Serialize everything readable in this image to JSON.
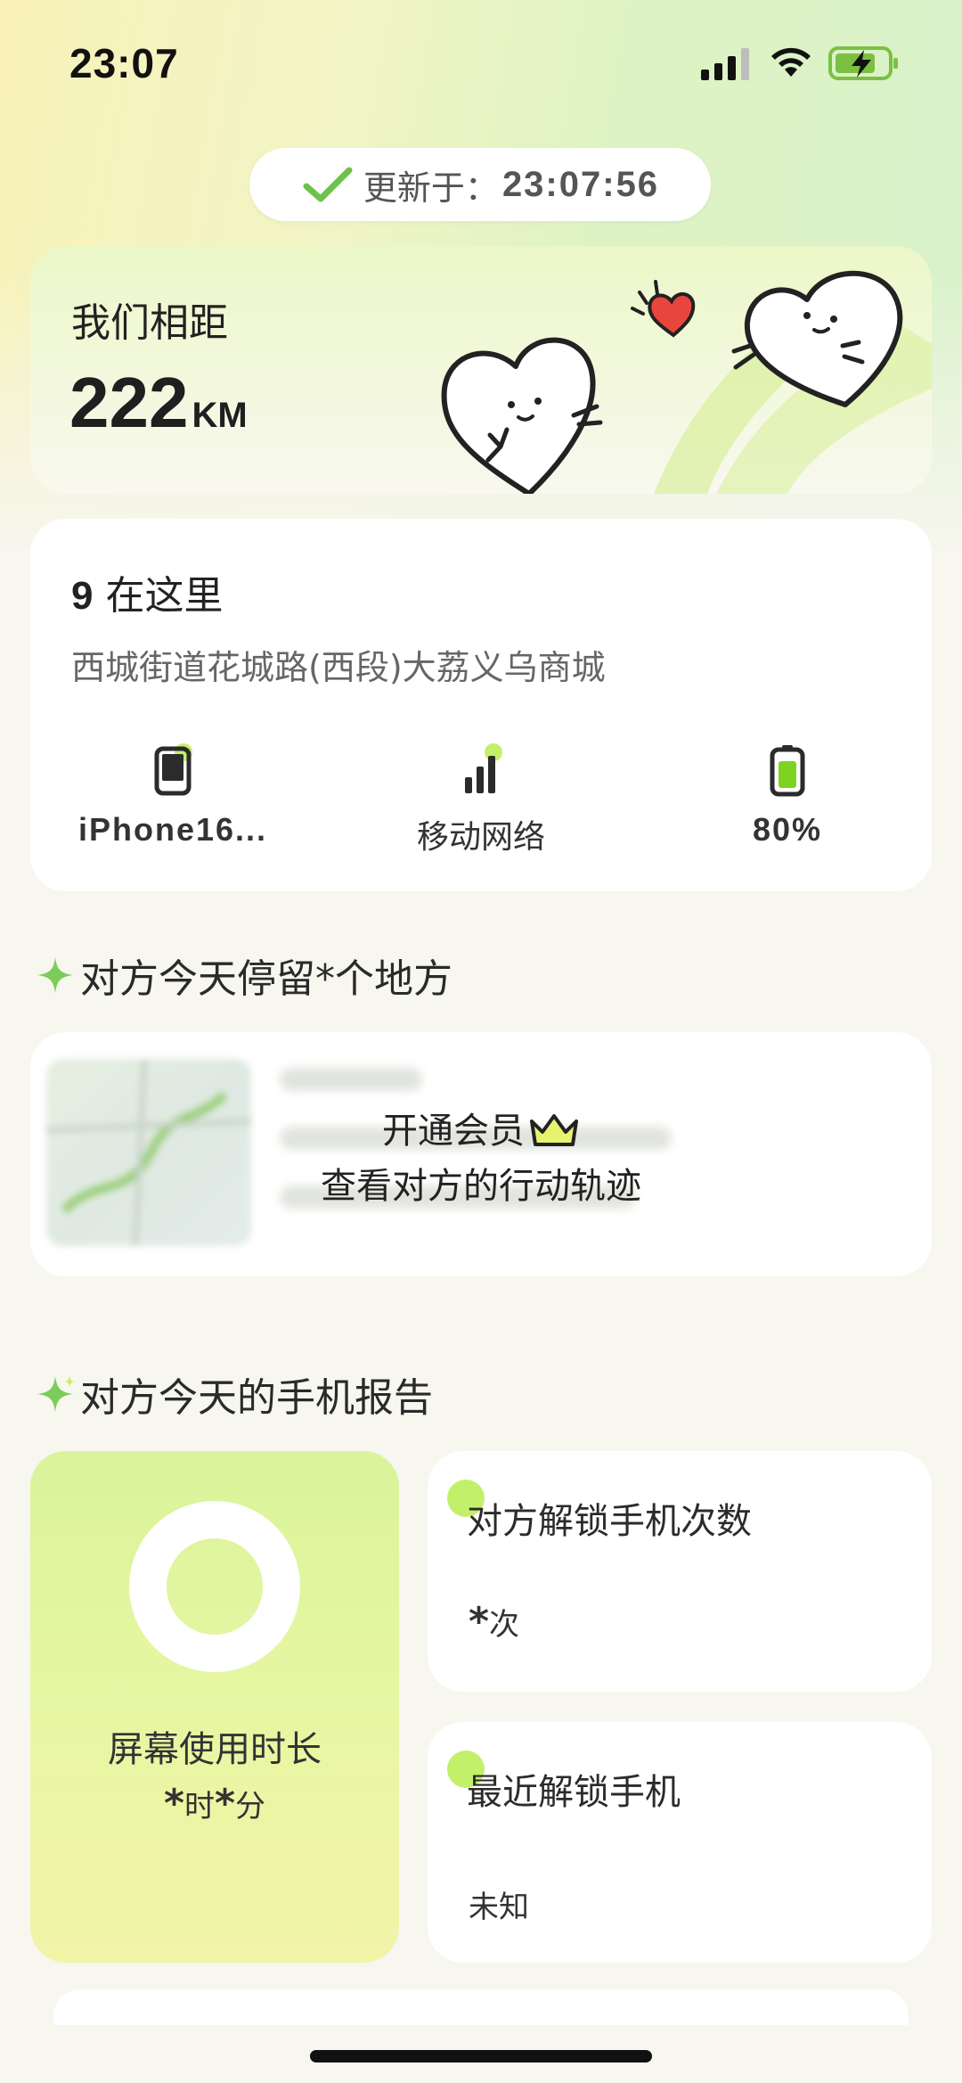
{
  "status_bar": {
    "time": "23:07",
    "battery_charging": true
  },
  "update": {
    "label": "更新于：",
    "time": "23:07:56"
  },
  "distance": {
    "title": "我们相距",
    "value": "222",
    "unit": "KM"
  },
  "location": {
    "count": "9",
    "title_suffix": " 在这里",
    "address": "西城街道花城路(西段)大荔义乌商城",
    "device": "iPhone16...",
    "network": "移动网络",
    "battery": "80%"
  },
  "places_section": {
    "title": "对方今天停留*个地方"
  },
  "vip": {
    "line1": "开通会员",
    "line2": "查看对方的行动轨迹"
  },
  "report_section": {
    "title": "对方今天的手机报告"
  },
  "screen_time": {
    "label": "屏幕使用时长",
    "hours": "*",
    "hours_unit": "时",
    "minutes": "*",
    "minutes_unit": "分"
  },
  "unlock_count": {
    "title": "对方解锁手机次数",
    "value": "*",
    "unit": "次"
  },
  "last_unlock": {
    "title": "最近解锁手机",
    "value": "未知"
  },
  "colors": {
    "accent_green": "#c3f06a",
    "check_green": "#6cc24a",
    "heart_red": "#e8453c"
  }
}
